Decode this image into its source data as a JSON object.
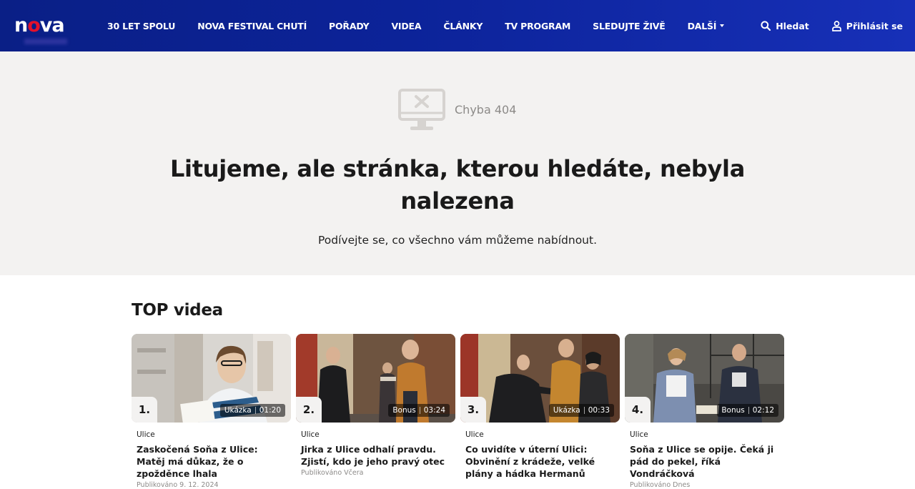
{
  "header": {
    "logo_text": "nova",
    "nav": [
      {
        "label": "30 LET SPOLU"
      },
      {
        "label": "NOVA FESTIVAL CHUTÍ"
      },
      {
        "label": "POŘADY"
      },
      {
        "label": "VIDEA"
      },
      {
        "label": "ČLÁNKY"
      },
      {
        "label": "TV PROGRAM"
      },
      {
        "label": "SLEDUJTE ŽIVĚ"
      },
      {
        "label": "DALŠÍ"
      }
    ],
    "search_label": "Hledat",
    "login_label": "Přihlásit se"
  },
  "error": {
    "code": "Chyba 404",
    "title": "Litujeme, ale stránka, kterou hledáte, nebyla nalezena",
    "subtitle": "Podívejte se, co všechno vám můžeme nabídnout."
  },
  "top_videos": {
    "title": "TOP videa",
    "items": [
      {
        "rank": "1.",
        "badge_type": "Ukázka",
        "duration": "01:20",
        "category": "Ulice",
        "title": "Zaskočená Soňa z Ulice: Matěj má důkaz, že o zpožděnce lhala",
        "date": "Publikováno 9. 12. 2024"
      },
      {
        "rank": "2.",
        "badge_type": "Bonus",
        "duration": "03:24",
        "category": "Ulice",
        "title": "Jirka z Ulice odhalí pravdu. Zjistí, kdo je jeho pravý otec",
        "date": "Publikováno Včera"
      },
      {
        "rank": "3.",
        "badge_type": "Ukázka",
        "duration": "00:33",
        "category": "Ulice",
        "title": "Co uvidíte v úterní Ulici: Obvinění z krádeže, velké plány a hádka Hermanů",
        "date": ""
      },
      {
        "rank": "4.",
        "badge_type": "Bonus",
        "duration": "02:12",
        "category": "Ulice",
        "title": "Soňa z Ulice se opije. Čeká ji pád do pekel, říká Vondráčková",
        "date": "Publikováno Dnes"
      }
    ]
  },
  "colors": {
    "header_bg": "#0c2399",
    "logo_accent": "#e3112b",
    "hero_bg": "#f3f2f1"
  },
  "icons": {
    "search": "search-icon",
    "user": "user-icon",
    "error": "monitor-error-icon",
    "dropdown": "caret-down-icon"
  }
}
